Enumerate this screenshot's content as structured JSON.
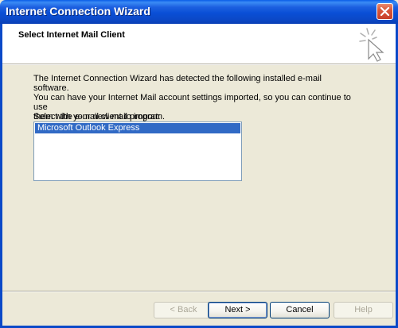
{
  "window": {
    "title": "Internet Connection Wizard"
  },
  "header": {
    "title": "Select Internet Mail Client"
  },
  "body": {
    "description_lines": [
      "The Internet Connection Wizard has detected the following installed e-mail software.",
      "You can have your Internet Mail account settings imported, so you can continue to use",
      "them with your new mail program."
    ],
    "list_label": "Select the e-mail client to import:",
    "list_items": [
      {
        "label": "Microsoft Outlook Express",
        "selected": true
      }
    ]
  },
  "buttons": {
    "back": "< Back",
    "next": "Next >",
    "cancel": "Cancel",
    "help": "Help"
  },
  "colors": {
    "titlebar": "#0a4fd6",
    "selection": "#316ac5",
    "dialog_bg": "#ece9d8"
  },
  "icons": {
    "close": "close-icon",
    "wizard": "wizard-sparkle-cursor-icon"
  }
}
